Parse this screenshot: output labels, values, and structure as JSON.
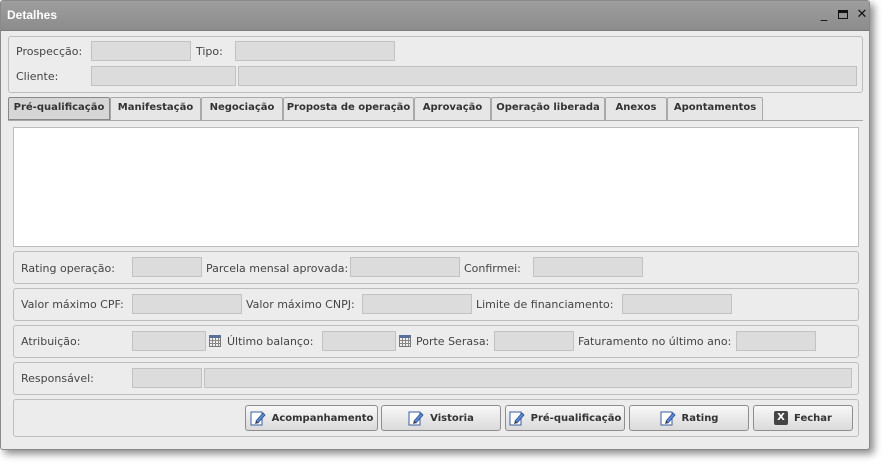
{
  "window": {
    "title": "Detalhes",
    "minimize": "_",
    "close": "✕"
  },
  "header": {
    "prospeccao_label": "Prospecção:",
    "tipo_label": "Tipo:",
    "cliente_label": "Cliente:"
  },
  "tabs": [
    {
      "label": "Pré-qualificação",
      "active": true
    },
    {
      "label": "Manifestação"
    },
    {
      "label": "Negociação"
    },
    {
      "label": "Proposta de operação"
    },
    {
      "label": "Aprovação"
    },
    {
      "label": "Operação liberada"
    },
    {
      "label": "Anexos"
    },
    {
      "label": "Apontamentos"
    }
  ],
  "rows": {
    "rating_operacao": "Rating operação:",
    "parcela_mensal": "Parcela mensal aprovada:",
    "confirmei": "Confirmei:",
    "valor_max_cpf": "Valor máximo CPF:",
    "valor_max_cnpj": "Valor máximo CNPJ:",
    "limite_financiamento": "Limite de financiamento:",
    "atribuicao": "Atribuição:",
    "ultimo_balanco": "Último balanço:",
    "porte_serasa": "Porte Serasa:",
    "faturamento": "Faturamento no último ano:",
    "responsavel": "Responsável:"
  },
  "buttons": {
    "acompanhamento": "Acompanhamento",
    "vistoria": "Vistoria",
    "pre_qualificacao": "Pré-qualificação",
    "rating": "Rating",
    "fechar": "Fechar"
  }
}
